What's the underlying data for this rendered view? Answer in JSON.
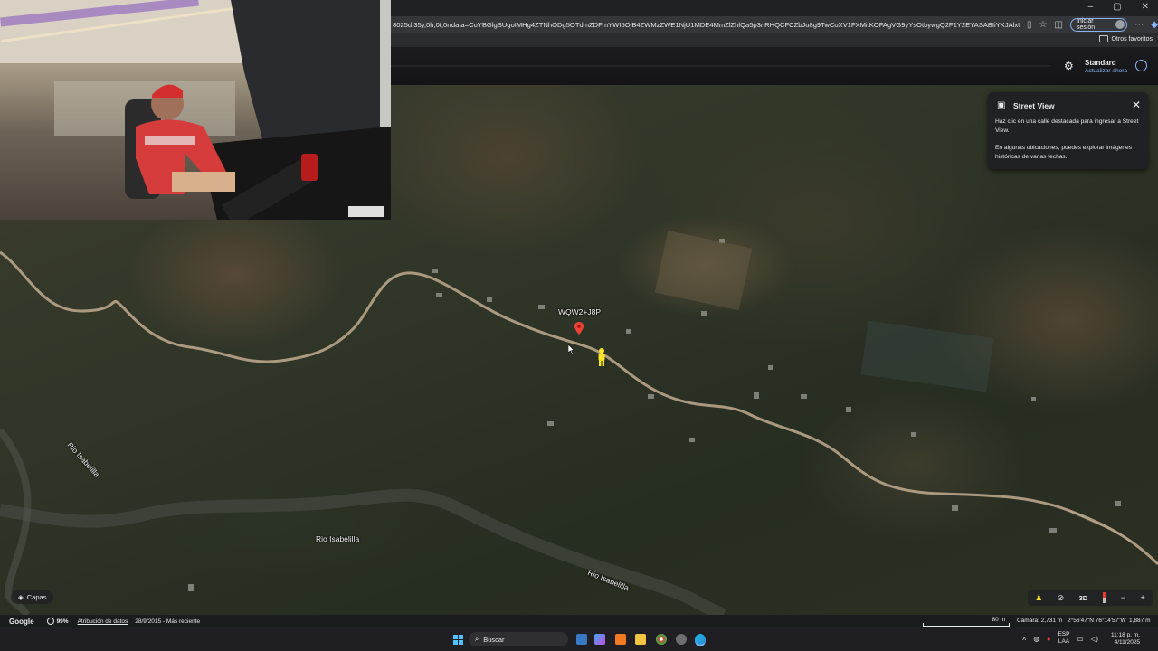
{
  "window_controls": {
    "minimize": "–",
    "maximize": "▢",
    "close": "✕"
  },
  "address_bar": {
    "url": "8025d,35y,0h,0t,0r/data=CoYBGlgSUgoIMHg4ZTNhODg5OTdmZDFmYWI5OjB4ZWMzZWE1NjU1MDE4MmZlZhlQa5p3nRHQCFCZbJu8g9TwCoXV1FXMitKOFAgVG9yYsOtbywgQ2F1Y2EYASABIiYKJAlxUSxPYHgzQBHyhO0UmnYz..."
  },
  "signin": {
    "label": "Iniciar sesión"
  },
  "bookmarks": {
    "other_favorites": "Otros favoritos"
  },
  "maps_header": {
    "plan_title": "Standard",
    "plan_link": "Actualizar ahora"
  },
  "street_view_card": {
    "title": "Street View",
    "text_1": "Haz clic en una calle destacada para ingresar a Street View.",
    "text_2": "En algunas ubicaciones, puedes explorar imágenes históricas de varias fechas."
  },
  "map_labels": {
    "plus_code": "WQW2+J8P",
    "river_1": "Rio Isabelilla",
    "river_2": "Rio Isabelilla",
    "river_3": "Rio Isabelilla"
  },
  "layers": {
    "label": "Capas"
  },
  "map_controls": {
    "three_d": "3D",
    "zoom_out": "−",
    "zoom_in": "+"
  },
  "attribution": {
    "logo": "Google",
    "percent": "99%",
    "data_attribution": "Atribución de datos",
    "imagery_date": "28/9/2015 - Más reciente",
    "scale": "80 m",
    "camera": "Cámara: 2,731 m",
    "coordinates": "2°56'47\"N 76°14'57\"W",
    "elevation": "1,887 m"
  },
  "taskbar": {
    "search_placeholder": "Buscar",
    "lang_top": "ESP",
    "lang_bottom": "LAA",
    "time": "11:18 p. m.",
    "date": "4/11/2025"
  },
  "colors": {
    "accent": "#8ab4f8",
    "pin": "#ea4335",
    "pegman": "#f9e425",
    "road": "#b9a58a"
  }
}
